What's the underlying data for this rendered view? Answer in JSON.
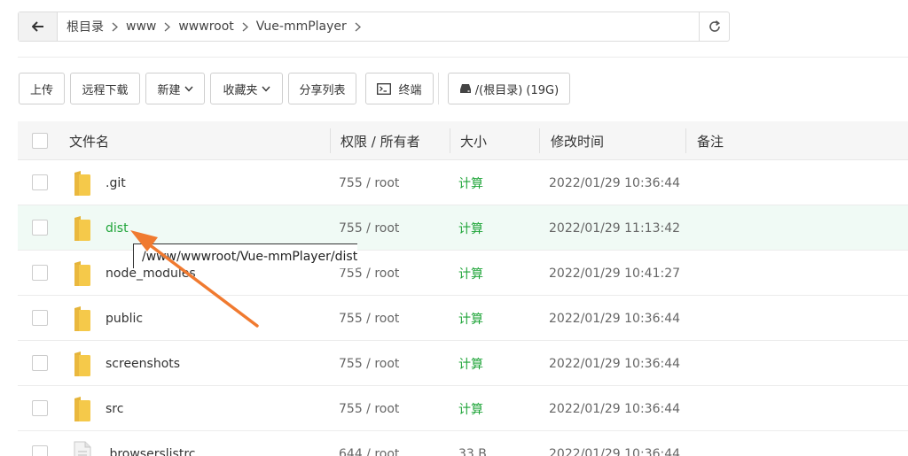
{
  "path_bar": {
    "back_icon": "arrow-left-icon",
    "crumbs": [
      "根目录",
      "www",
      "wwwroot",
      "Vue-mmPlayer"
    ],
    "refresh_icon": "refresh-icon"
  },
  "toolbar": {
    "upload": "上传",
    "remote_download": "远程下载",
    "new": "新建",
    "favorites": "收藏夹",
    "share_list": "分享列表",
    "terminal": "终端",
    "disk": "/(根目录) (19G)"
  },
  "table": {
    "headers": {
      "name": "文件名",
      "perm": "权限 / 所有者",
      "size": "大小",
      "mtime": "修改时间",
      "note": "备注"
    },
    "rows": [
      {
        "name": ".git",
        "perm": "755 / root",
        "size": "计算",
        "mtime": "2022/01/29 10:36:44",
        "type": "folder"
      },
      {
        "name": "dist",
        "perm": "755 / root",
        "size": "计算",
        "mtime": "2022/01/29 11:13:42",
        "type": "folder"
      },
      {
        "name": "node_modules",
        "perm": "755 / root",
        "size": "计算",
        "mtime": "2022/01/29 10:41:27",
        "type": "folder"
      },
      {
        "name": "public",
        "perm": "755 / root",
        "size": "计算",
        "mtime": "2022/01/29 10:36:44",
        "type": "folder"
      },
      {
        "name": "screenshots",
        "perm": "755 / root",
        "size": "计算",
        "mtime": "2022/01/29 10:36:44",
        "type": "folder"
      },
      {
        "name": "src",
        "perm": "755 / root",
        "size": "计算",
        "mtime": "2022/01/29 10:36:44",
        "type": "folder"
      },
      {
        "name": ".browserslistrc",
        "perm": "644 / root",
        "size": "33 B",
        "mtime": "2022/01/29 10:36:44",
        "type": "file"
      }
    ]
  },
  "tooltip": "/www/wwwroot/Vue-mmPlayer/dist",
  "colors": {
    "accent_green": "#20a53a",
    "highlight_row": "#f0faf5",
    "folder_yellow": "#f5c94a",
    "annotation_arrow": "#f07a30"
  }
}
